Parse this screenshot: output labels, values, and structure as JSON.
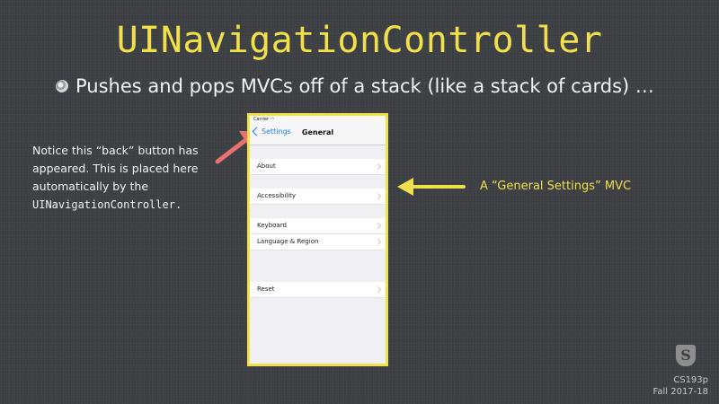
{
  "slide": {
    "title": "UINavigationController",
    "bullet": "Pushes and pops MVCs off of a stack (like a stack of cards) …",
    "note_line1": "Notice this “back” button has",
    "note_line2": "appeared.  This is placed here",
    "note_line3": "automatically by the",
    "note_line4": "UINavigationController.",
    "mvc_label": "A “General Settings” MVC",
    "course": "CS193p",
    "term": "Fall 2017-18",
    "logo_letter": "S",
    "colors": {
      "accent": "#f2e04a",
      "arrow_red": "#e8706d",
      "background": "#3c3f43"
    }
  },
  "phone": {
    "carrier": "Carrier",
    "back_label": "Settings",
    "nav_title": "General",
    "rows": [
      "About",
      "Accessibility",
      "Keyboard",
      "Language & Region",
      "Reset"
    ]
  }
}
